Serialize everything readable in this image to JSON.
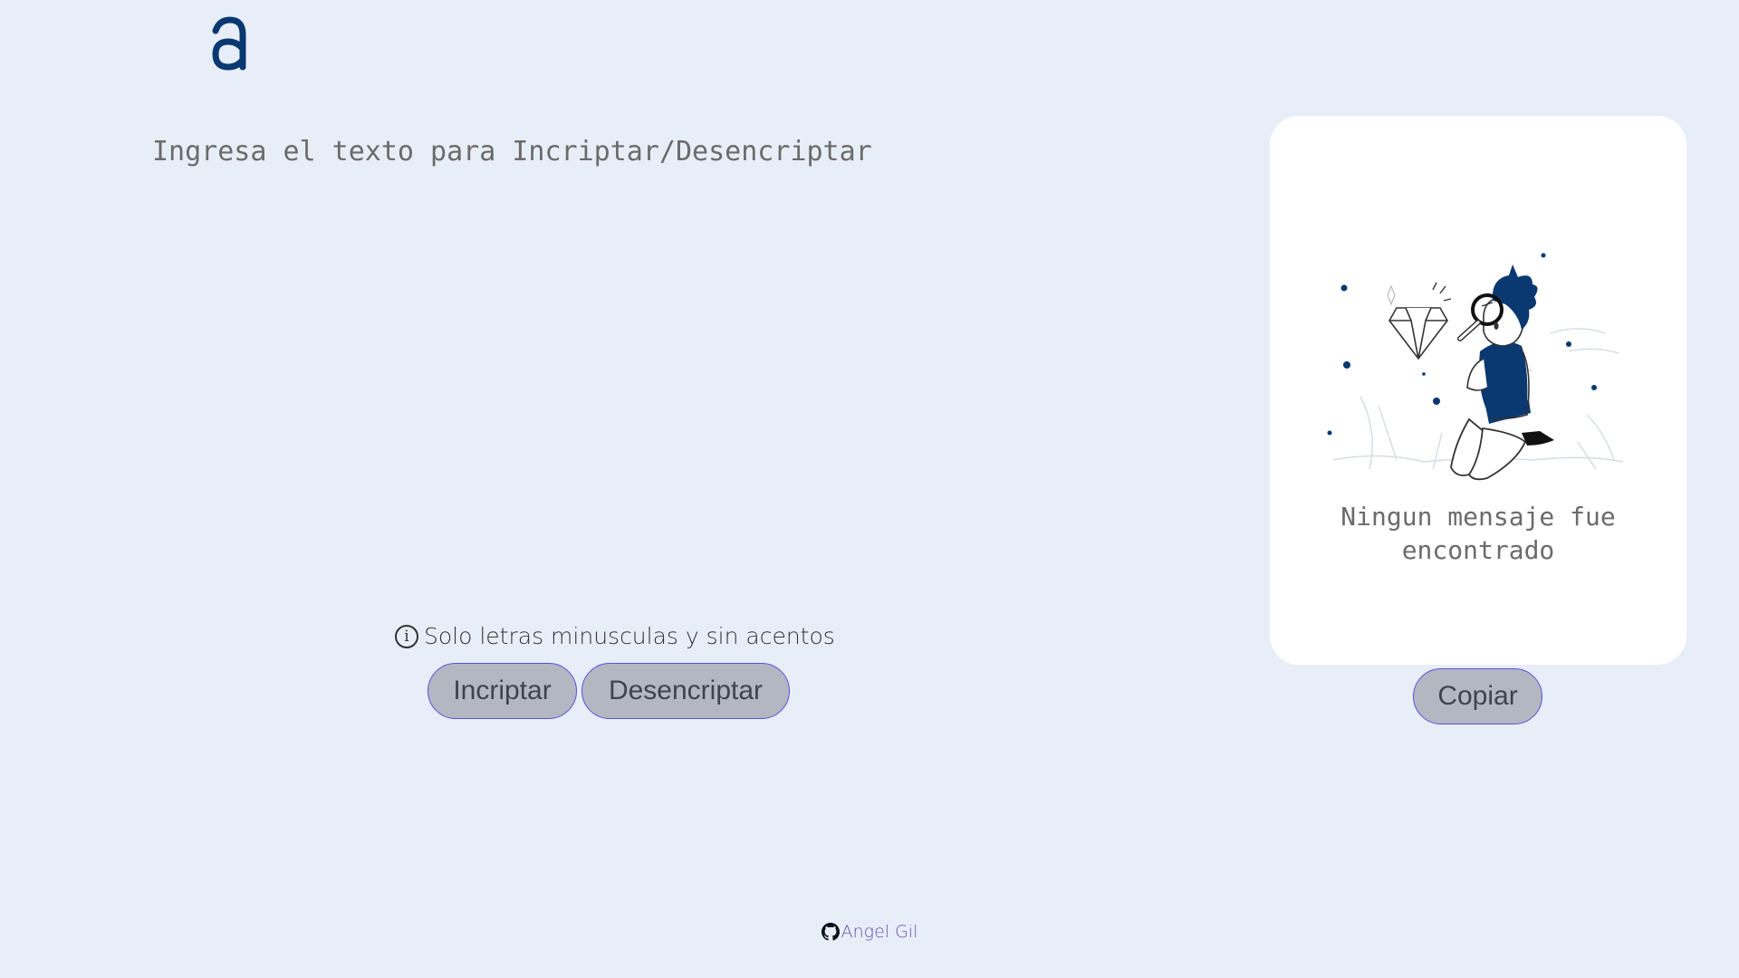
{
  "logo": {
    "icon": "alura-logo-icon",
    "color": "#0a3871"
  },
  "input": {
    "placeholder": "Ingresa el texto para Incriptar/Desencriptar",
    "value": ""
  },
  "hint": {
    "icon": "info-icon",
    "icon_glyph": "i",
    "text": "Solo letras minusculas y sin acentos"
  },
  "buttons": {
    "encrypt_label": "Incriptar",
    "decrypt_label": "Desencriptar"
  },
  "output": {
    "illustration": "person-with-magnifying-glass-illustration",
    "empty_message": "Ningun mensaje fue encontrado",
    "copy_label": "Copiar"
  },
  "footer": {
    "icon": "github-icon",
    "author": "Angel Gil"
  },
  "colors": {
    "background": "#e8eef8",
    "accent": "#0a3871",
    "button_fill": "#b3b7c1",
    "button_border": "#5b4fe0",
    "footer_link": "#6b4fb0"
  }
}
